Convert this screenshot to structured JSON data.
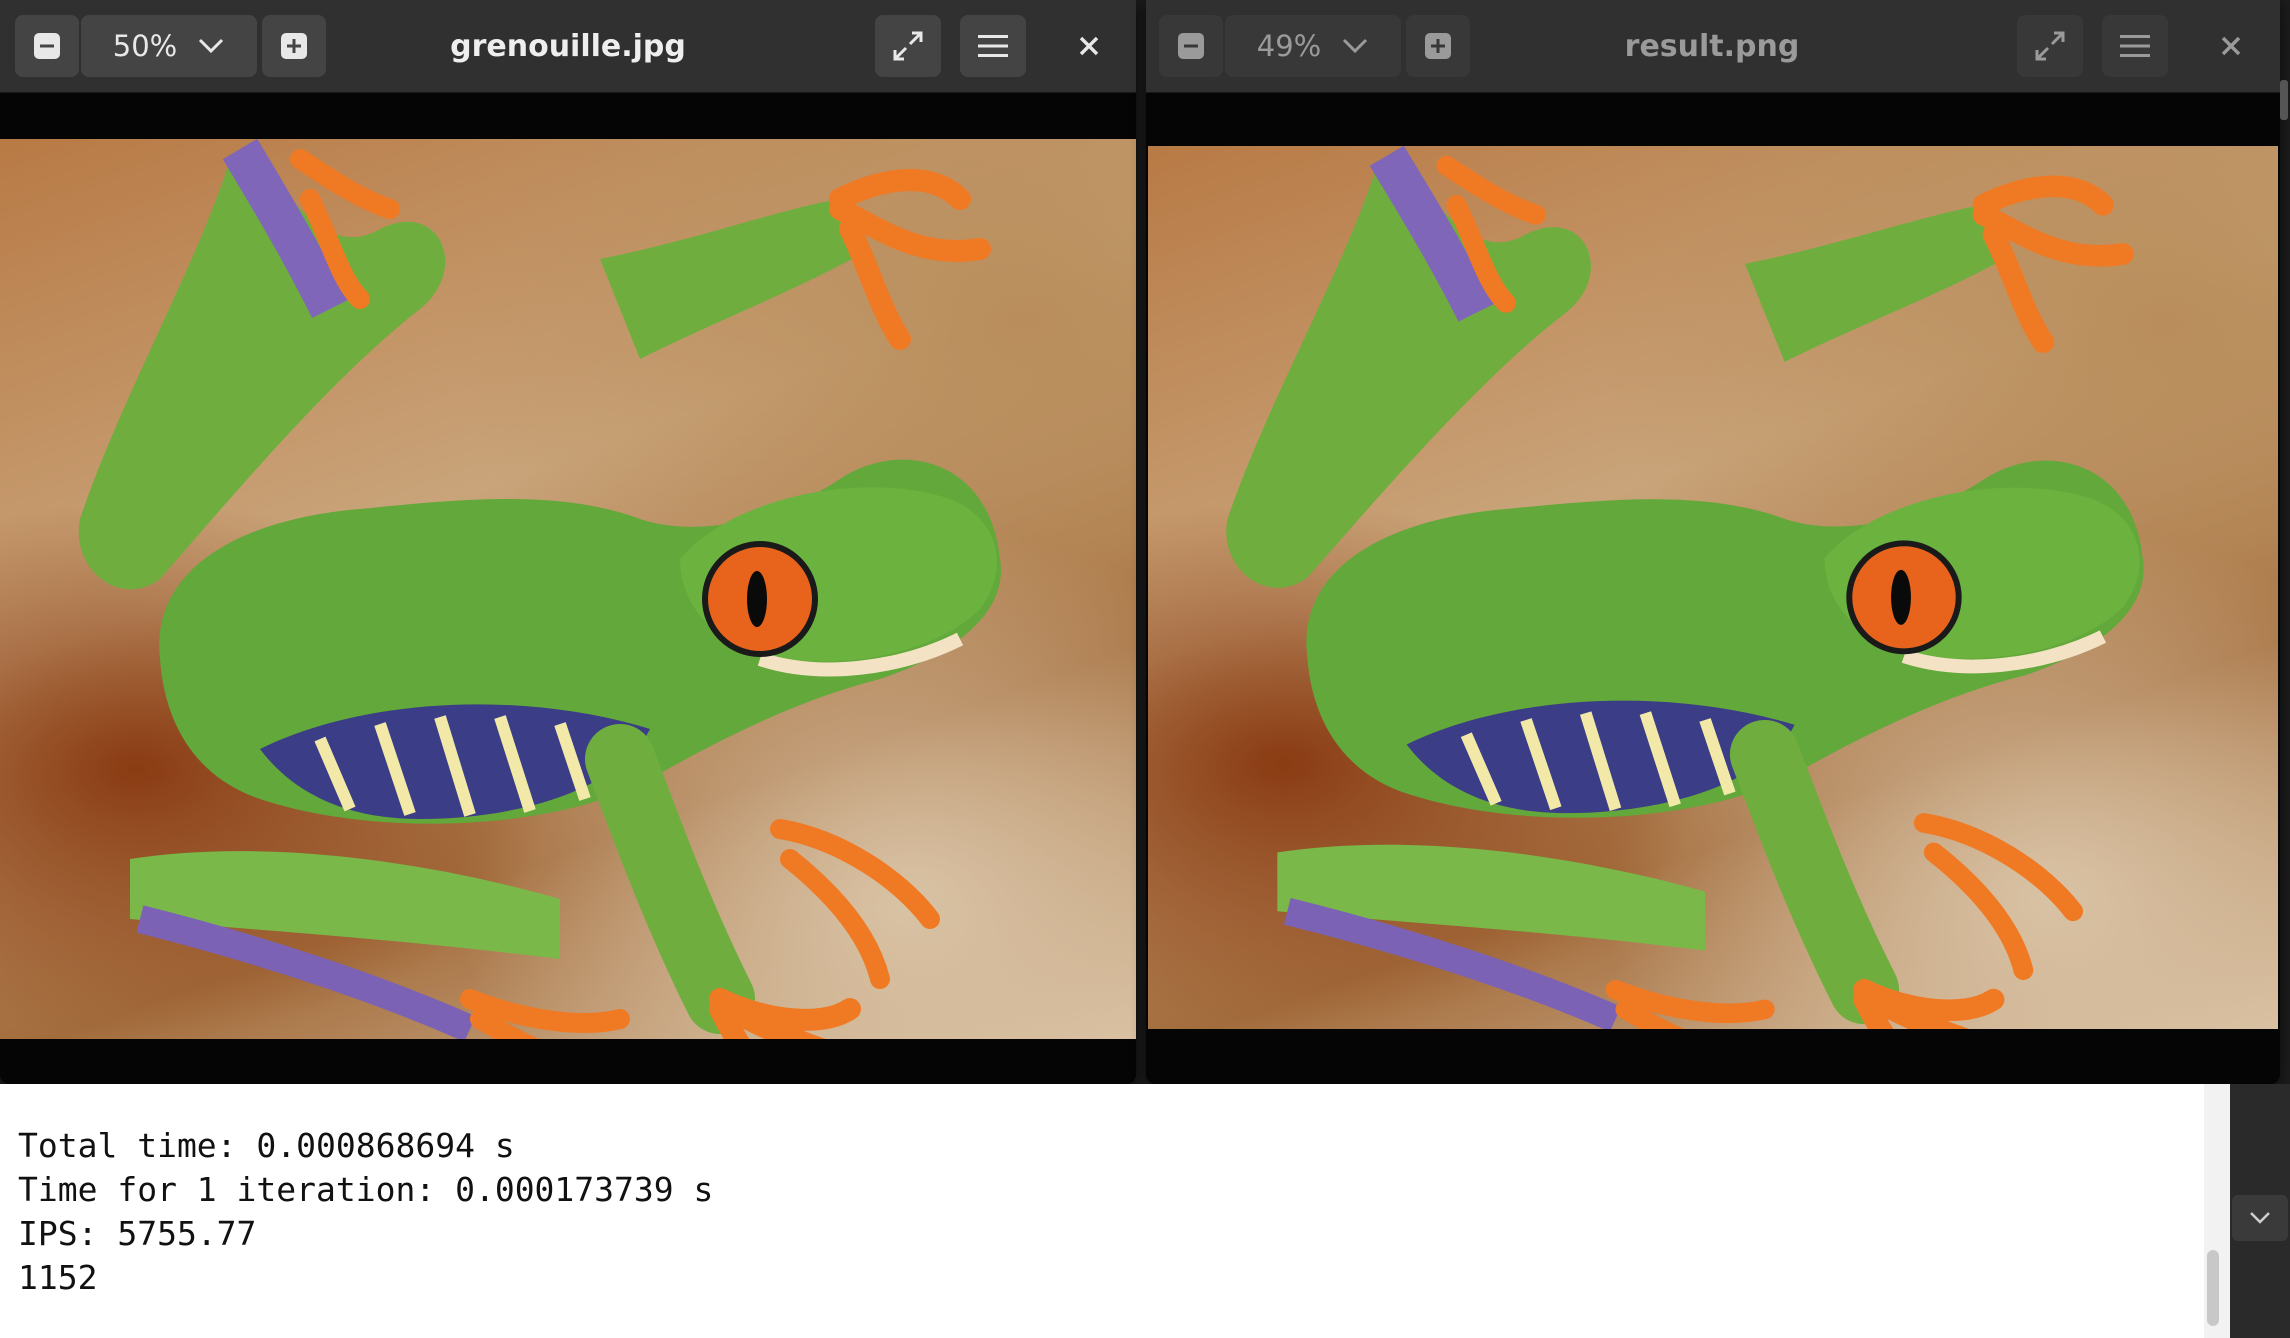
{
  "viewers": [
    {
      "zoom": "50%",
      "title": "grenouille.jpg",
      "active": true,
      "icons": {
        "zoom_out": "minus-square-icon",
        "zoom_menu": "chevron-down-icon",
        "zoom_in": "plus-square-icon",
        "fullscreen": "expand-arrows-icon",
        "menu": "hamburger-menu-icon",
        "close": "close-icon"
      }
    },
    {
      "zoom": "49%",
      "title": "result.png",
      "active": false,
      "icons": {
        "zoom_out": "minus-square-icon",
        "zoom_menu": "chevron-down-icon",
        "zoom_in": "plus-square-icon",
        "fullscreen": "expand-arrows-icon",
        "menu": "hamburger-menu-icon",
        "close": "close-icon"
      }
    }
  ],
  "terminal": {
    "lines": [
      "Total time: 0.000868694 s",
      "Time for 1 iteration: 0.000173739 s",
      "IPS: 5755.77",
      "1152"
    ]
  },
  "colors": {
    "headerbar": "#303030",
    "button": "#444444",
    "terminal_bg": "#ffffff",
    "frog_green": "#6aa83a",
    "frog_eye": "#e8641c"
  }
}
